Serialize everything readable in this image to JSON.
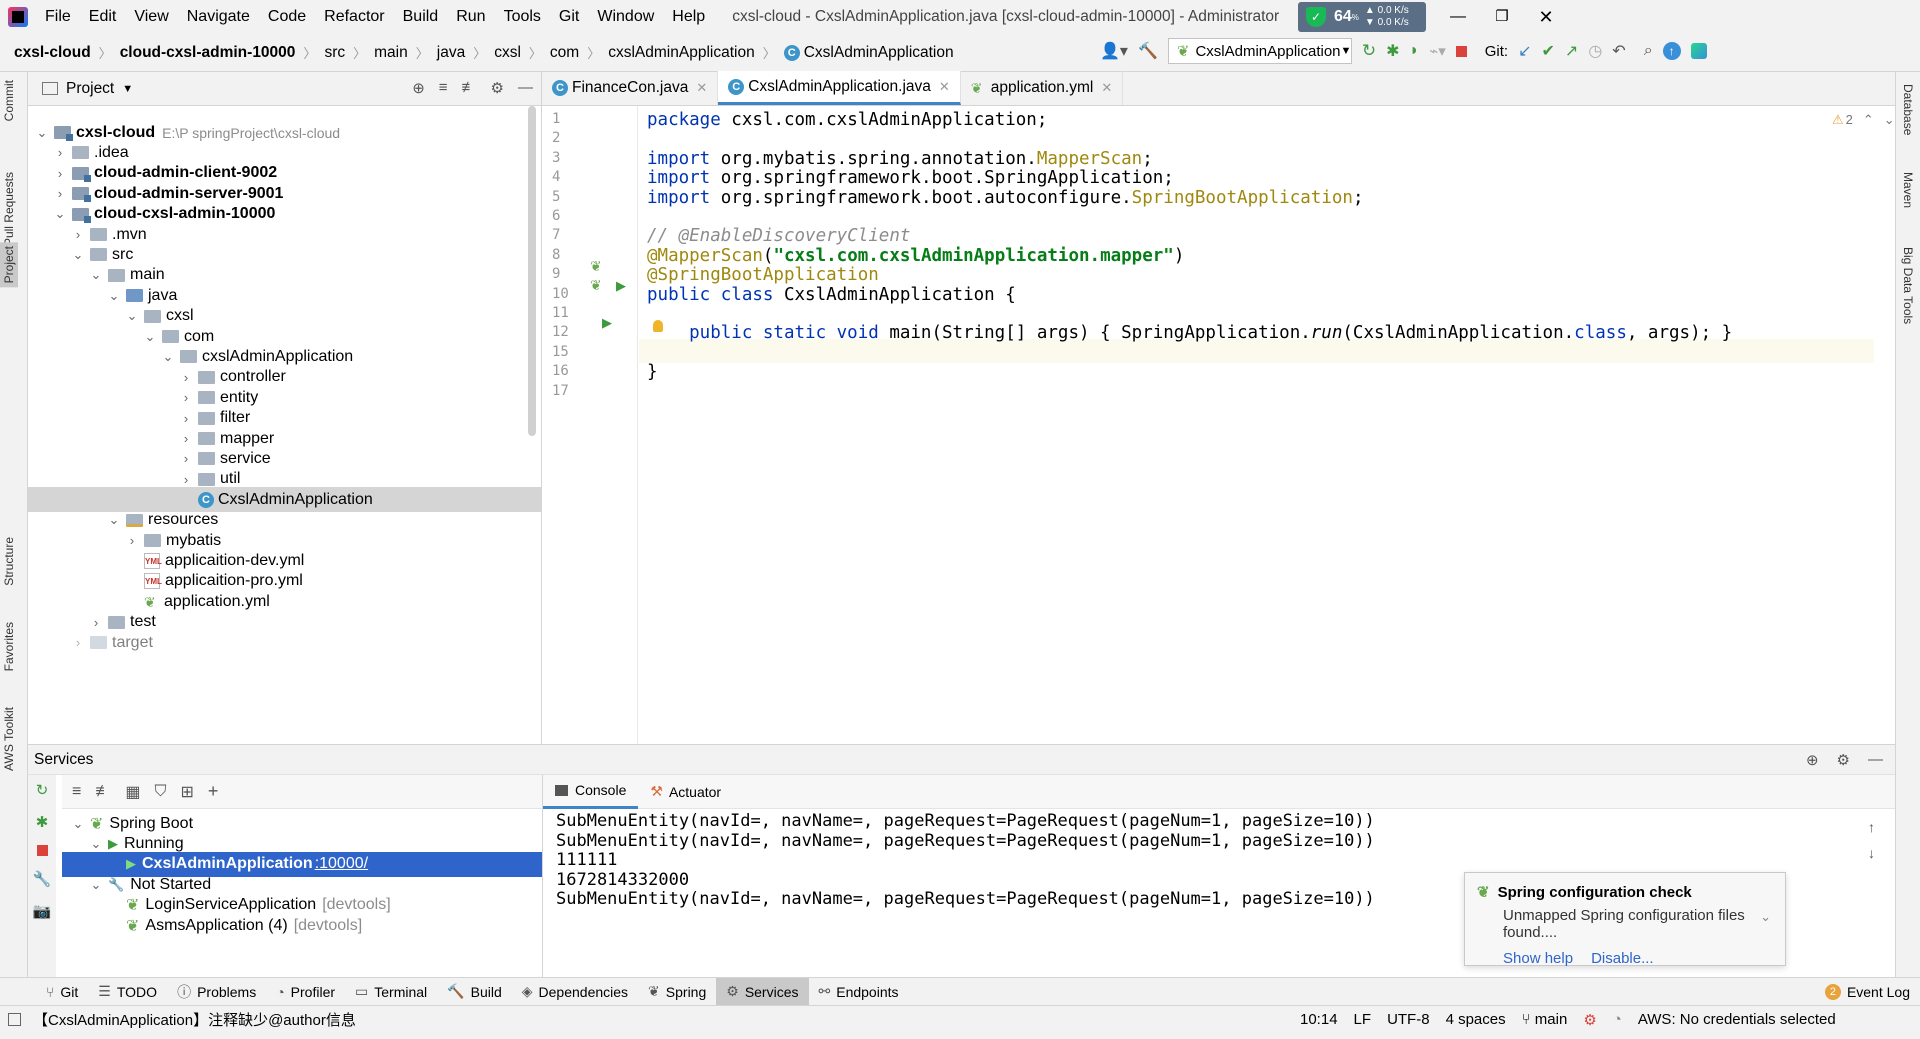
{
  "window": {
    "title": "cxsl-cloud - CxslAdminApplication.java [cxsl-cloud-admin-10000] - Administrator",
    "menu": [
      "File",
      "Edit",
      "View",
      "Navigate",
      "Code",
      "Refactor",
      "Build",
      "Run",
      "Tools",
      "Git",
      "Window",
      "Help"
    ],
    "cpu_widget": {
      "percent": "64",
      "unit": "%",
      "up": "0.0",
      "down": "0.0",
      "speed_unit": "K/s"
    }
  },
  "navbar": {
    "crumbs": [
      "cxsl-cloud",
      "cloud-cxsl-admin-10000",
      "src",
      "main",
      "java",
      "cxsl",
      "com",
      "cxslAdminApplication",
      "CxslAdminApplication"
    ],
    "run_config": "CxslAdminApplication",
    "git_label": "Git:"
  },
  "left_strip": [
    "Commit",
    "Pull Requests",
    "Project",
    "Structure",
    "Favorites",
    "AWS Toolkit"
  ],
  "right_strip": [
    "Database",
    "Maven",
    "Big Data Tools"
  ],
  "project": {
    "title": "Project",
    "tree": [
      {
        "label": "cxsl-cloud",
        "extra": "E:\\P springProject\\cxsl-cloud",
        "depth": 0,
        "arrow": "down",
        "icon": "module",
        "bold": true
      },
      {
        "label": ".idea",
        "depth": 1,
        "arrow": "right",
        "icon": "folder"
      },
      {
        "label": "cloud-admin-client-9002",
        "depth": 1,
        "arrow": "right",
        "icon": "module",
        "bold": true
      },
      {
        "label": "cloud-admin-server-9001",
        "depth": 1,
        "arrow": "right",
        "icon": "module",
        "bold": true
      },
      {
        "label": "cloud-cxsl-admin-10000",
        "depth": 1,
        "arrow": "down",
        "icon": "module",
        "bold": true
      },
      {
        "label": ".mvn",
        "depth": 2,
        "arrow": "right",
        "icon": "folder"
      },
      {
        "label": "src",
        "depth": 2,
        "arrow": "down",
        "icon": "folder"
      },
      {
        "label": "main",
        "depth": 3,
        "arrow": "down",
        "icon": "folder"
      },
      {
        "label": "java",
        "depth": 4,
        "arrow": "down",
        "icon": "src"
      },
      {
        "label": "cxsl",
        "depth": 5,
        "arrow": "down",
        "icon": "folder"
      },
      {
        "label": "com",
        "depth": 6,
        "arrow": "down",
        "icon": "folder"
      },
      {
        "label": "cxslAdminApplication",
        "depth": 7,
        "arrow": "down",
        "icon": "folder"
      },
      {
        "label": "controller",
        "depth": 8,
        "arrow": "right",
        "icon": "folder"
      },
      {
        "label": "entity",
        "depth": 8,
        "arrow": "right",
        "icon": "folder"
      },
      {
        "label": "filter",
        "depth": 8,
        "arrow": "right",
        "icon": "folder"
      },
      {
        "label": "mapper",
        "depth": 8,
        "arrow": "right",
        "icon": "folder"
      },
      {
        "label": "service",
        "depth": 8,
        "arrow": "right",
        "icon": "folder"
      },
      {
        "label": "util",
        "depth": 8,
        "arrow": "right",
        "icon": "folder"
      },
      {
        "label": "CxslAdminApplication",
        "depth": 8,
        "arrow": "",
        "icon": "class",
        "selected": true
      },
      {
        "label": "resources",
        "depth": 4,
        "arrow": "down",
        "icon": "res"
      },
      {
        "label": "mybatis",
        "depth": 5,
        "arrow": "right",
        "icon": "folder"
      },
      {
        "label": "applicaition-dev.yml",
        "depth": 5,
        "arrow": "",
        "icon": "yml"
      },
      {
        "label": "applicaition-pro.yml",
        "depth": 5,
        "arrow": "",
        "icon": "yml"
      },
      {
        "label": "application.yml",
        "depth": 5,
        "arrow": "",
        "icon": "leaf"
      },
      {
        "label": "test",
        "depth": 3,
        "arrow": "right",
        "icon": "folder"
      },
      {
        "label": "target",
        "depth": 2,
        "arrow": "right",
        "icon": "folder",
        "faded": true
      }
    ]
  },
  "editor": {
    "tabs": [
      {
        "label": "FinanceCon.java",
        "icon": "class"
      },
      {
        "label": "CxslAdminApplication.java",
        "icon": "class",
        "active": true
      },
      {
        "label": "application.yml",
        "icon": "leaf"
      }
    ],
    "warnings": "2",
    "line_numbers": [
      "1",
      "2",
      "3",
      "4",
      "5",
      "6",
      "7",
      "8",
      "9",
      "10",
      "11",
      "12",
      "15",
      "16",
      "17"
    ],
    "lines": [
      [
        {
          "t": "package ",
          "c": "kw"
        },
        {
          "t": "cxsl.com.cxslAdminApplication;"
        }
      ],
      [],
      [
        {
          "t": "import ",
          "c": "kw"
        },
        {
          "t": "org.mybatis.spring.annotation."
        },
        {
          "t": "MapperScan",
          "c": "ann"
        },
        {
          "t": ";"
        }
      ],
      [
        {
          "t": "import ",
          "c": "kw"
        },
        {
          "t": "org.springframework.boot.SpringApplication;"
        }
      ],
      [
        {
          "t": "import ",
          "c": "kw"
        },
        {
          "t": "org.springframework.boot.autoconfigure."
        },
        {
          "t": "SpringBootApplication",
          "c": "ann"
        },
        {
          "t": ";"
        }
      ],
      [],
      [
        {
          "t": "// @EnableDiscoveryClient",
          "c": "cmt"
        }
      ],
      [
        {
          "t": "@MapperScan",
          "c": "ann"
        },
        {
          "t": "("
        },
        {
          "t": "\"cxsl.com.cxslAdminApplication.mapper\"",
          "c": "str"
        },
        {
          "t": ")"
        }
      ],
      [
        {
          "t": "@SpringBootApplication",
          "c": "ann"
        }
      ],
      [
        {
          "t": "public class ",
          "c": "kw"
        },
        {
          "t": "CxslAdminApplication {"
        }
      ],
      [],
      [
        {
          "t": "    public static void ",
          "c": "kw"
        },
        {
          "t": "main(String[] args) { SpringApplication."
        },
        {
          "t": "run",
          "c": "it"
        },
        {
          "t": "(CxslAdminApplication."
        },
        {
          "t": "class",
          "c": "kw"
        },
        {
          "t": ", args); }"
        }
      ],
      [],
      [
        {
          "t": "}"
        }
      ],
      []
    ]
  },
  "services": {
    "title": "Services",
    "tree": [
      {
        "label": "Spring Boot",
        "depth": 0,
        "arrow": "down"
      },
      {
        "label": "Running",
        "depth": 1,
        "arrow": "down"
      },
      {
        "label": "CxslAdminApplication",
        "extra": ":10000/",
        "depth": 2,
        "arrow": "",
        "selected": true
      },
      {
        "label": "Not Started",
        "depth": 1,
        "arrow": "down"
      },
      {
        "label": "LoginServiceApplication",
        "extra": "[devtools]",
        "depth": 2,
        "arrow": ""
      },
      {
        "label": "AsmsApplication (4)",
        "extra": "[devtools]",
        "depth": 2,
        "arrow": ""
      }
    ],
    "console_tabs": [
      "Console",
      "Actuator"
    ],
    "console_lines": [
      "SubMenuEntity(navId=, navName=, pageRequest=PageRequest(pageNum=1, pageSize=10))",
      "SubMenuEntity(navId=, navName=, pageRequest=PageRequest(pageNum=1, pageSize=10))",
      "111111",
      "1672814332000",
      "SubMenuEntity(navId=, navName=, pageRequest=PageRequest(pageNum=1, pageSize=10))"
    ]
  },
  "notification": {
    "title": "Spring configuration check",
    "body": "Unmapped Spring configuration files found....",
    "link1": "Show help",
    "link2": "Disable..."
  },
  "bottom_tabs": [
    "Git",
    "TODO",
    "Problems",
    "Profiler",
    "Terminal",
    "Build",
    "Dependencies",
    "Spring",
    "Services",
    "Endpoints"
  ],
  "event_log": {
    "count": "2",
    "label": "Event Log"
  },
  "status": {
    "message": "【CxslAdminApplication】注释缺少@author信息",
    "position": "10:14",
    "line_sep": "LF",
    "encoding": "UTF-8",
    "indent": "4 spaces",
    "branch": "main",
    "aws": "AWS: No credentials selected"
  },
  "colors": {
    "accent": "#2f65ca",
    "keyword": "#0033b3",
    "string": "#067d17",
    "annotation": "#9e880d",
    "comment": "#8c8c8c"
  }
}
